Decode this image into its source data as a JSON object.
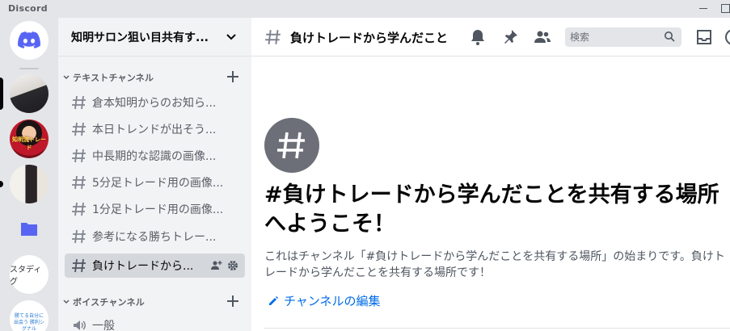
{
  "window": {
    "app_name": "Discord"
  },
  "server_rail": {
    "servers": [
      {
        "name": "server-1"
      },
      {
        "name": "server-2",
        "overlay": "知明流トレード"
      },
      {
        "name": "server-3"
      }
    ],
    "text_server": "スタディグ",
    "last_server_text": "勝てる自分に出会う 勝利シグナル"
  },
  "sidebar": {
    "guild_name": "知明サロン狙い目共有す...",
    "text_category": "テキストチャンネル",
    "voice_category": "ボイスチャンネル",
    "channels": [
      {
        "label": "倉本知明からのお知ら..."
      },
      {
        "label": "本日トレンドが出そう..."
      },
      {
        "label": "中長期的な認識の画像..."
      },
      {
        "label": "5分足トレード用の画像..."
      },
      {
        "label": "1分足トレード用の画像..."
      },
      {
        "label": "参考になる勝ちトレー..."
      },
      {
        "label": "負けトレードから..."
      }
    ],
    "voice_channels": [
      {
        "label": "一般"
      }
    ]
  },
  "header": {
    "channel_title": "負けトレードから学んだこと",
    "search_placeholder": "検索"
  },
  "welcome": {
    "title": "#負けトレードから学んだことを共有する場所へようこそ！",
    "subtitle": "これはチャンネル「#負けトレードから学んだことを共有する場所」の始まりです。負けトレードから学んだことを共有する場所です！",
    "edit_label": "チャンネルの編集"
  },
  "colors": {
    "rail_bg": "#e3e5e8",
    "sidebar_bg": "#f2f3f5",
    "active_channel": "#d4d7dc",
    "discord_blurple": "#5865f2",
    "link": "#006ce7"
  }
}
